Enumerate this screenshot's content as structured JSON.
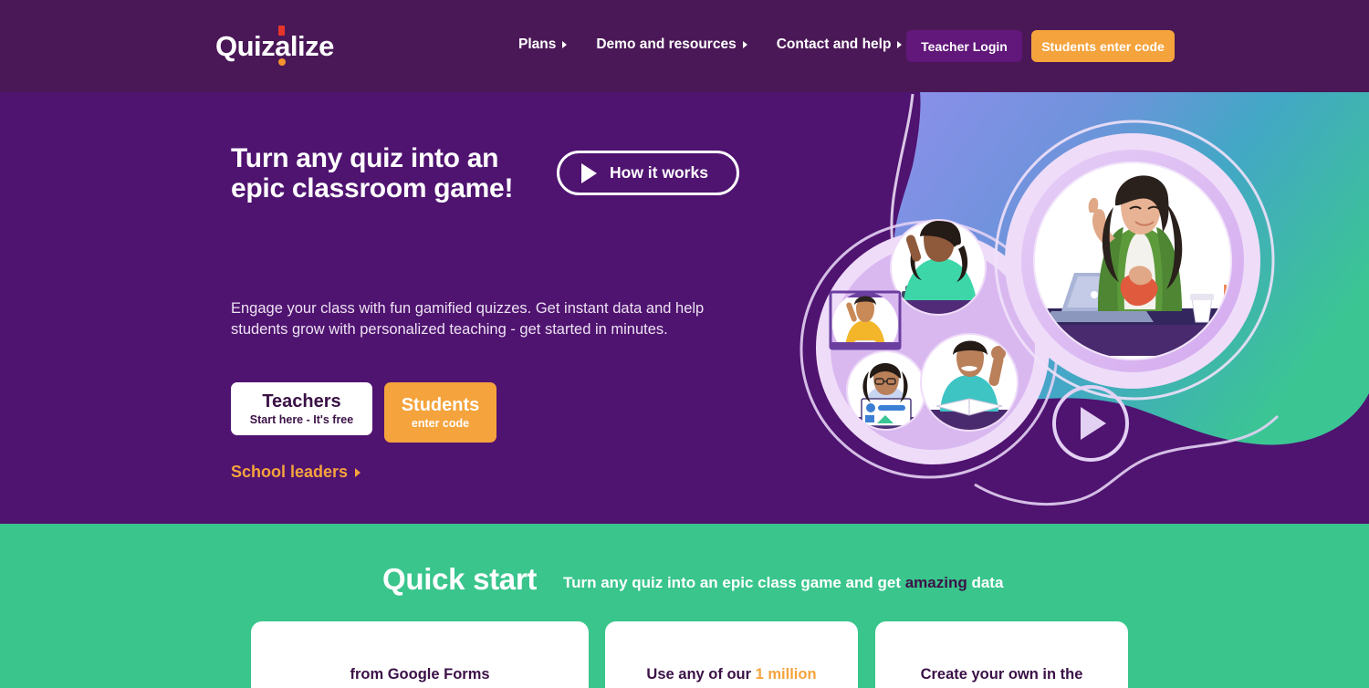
{
  "brand": {
    "name": "Quizalize",
    "logo_part_1": "Quiz",
    "logo_part_2": "a",
    "logo_part_3": "lize",
    "colors": {
      "header_purple": "#4A1857",
      "hero_purple": "#4F1370",
      "green": "#39C58C",
      "orange": "#F5A33C",
      "dark_text": "#3B1147",
      "logo_red": "#E8352B",
      "logo_orange": "#F5932E",
      "blob_blue": "#8A8FE8",
      "blob_teal": "#3FA6C4",
      "blob_green": "#3DC492",
      "circle_lavender": "#D6B4EE",
      "circle_light": "#EFDCF9"
    }
  },
  "header": {
    "nav": [
      {
        "label": "Plans",
        "icon": "chevron-right-icon"
      },
      {
        "label": "Demo and resources",
        "icon": "chevron-right-icon"
      },
      {
        "label": "Contact and help",
        "icon": "chevron-right-icon"
      }
    ],
    "teacher_login": "Teacher Login",
    "students_enter_code": "Students enter code"
  },
  "hero": {
    "headline": "Turn any quiz into an epic classroom game!",
    "how_it_works": "How it works",
    "how_it_works_icon": "play-icon",
    "subcopy": "Engage your class with fun gamified quizzes. Get instant data and help students grow with personalized teaching - get started in minutes.",
    "cta_teachers": {
      "title": "Teachers",
      "subtitle": "Start here - It's free"
    },
    "cta_students": {
      "title": "Students",
      "subtitle": "enter code"
    },
    "school_leaders": {
      "label": "School leaders",
      "icon": "chevron-right-icon"
    },
    "illustration": {
      "name": "classroom-illustration",
      "play_button_icon": "play-circle-icon"
    }
  },
  "quick_start": {
    "title": "Quick start",
    "tagline_before": "Turn any quiz into an epic class game and get ",
    "tagline_highlight": "amazing",
    "tagline_after": " data",
    "cards": [
      {
        "text": "from Google Forms",
        "highlight": ""
      },
      {
        "text_before": "Use any of our ",
        "highlight": "1 million",
        "text_after": ""
      },
      {
        "text": "Create your own in the",
        "highlight": ""
      }
    ]
  }
}
